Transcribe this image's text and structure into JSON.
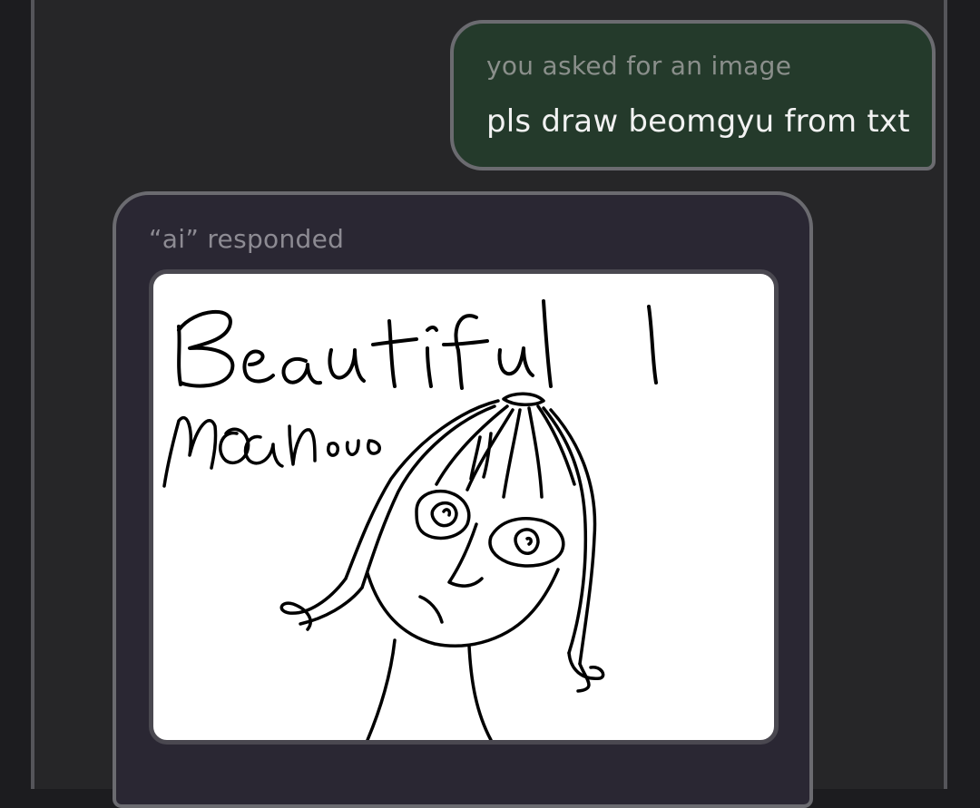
{
  "user_message": {
    "caption": "you asked for an image",
    "text": "pls draw beomgyu from txt",
    "colors": {
      "background": "#243a2b",
      "border": "#6b6b70"
    }
  },
  "ai_message": {
    "caption": "“ai” responded",
    "image": {
      "kind": "hand-drawn sketch",
      "handwritten_text": [
        "Beautiful",
        "man",
        "ouo"
      ]
    },
    "colors": {
      "background": "#2a2733",
      "border": "#6b6b70"
    }
  },
  "theme": {
    "page_background": "#1c1c1f",
    "panel_background": "#262628"
  }
}
